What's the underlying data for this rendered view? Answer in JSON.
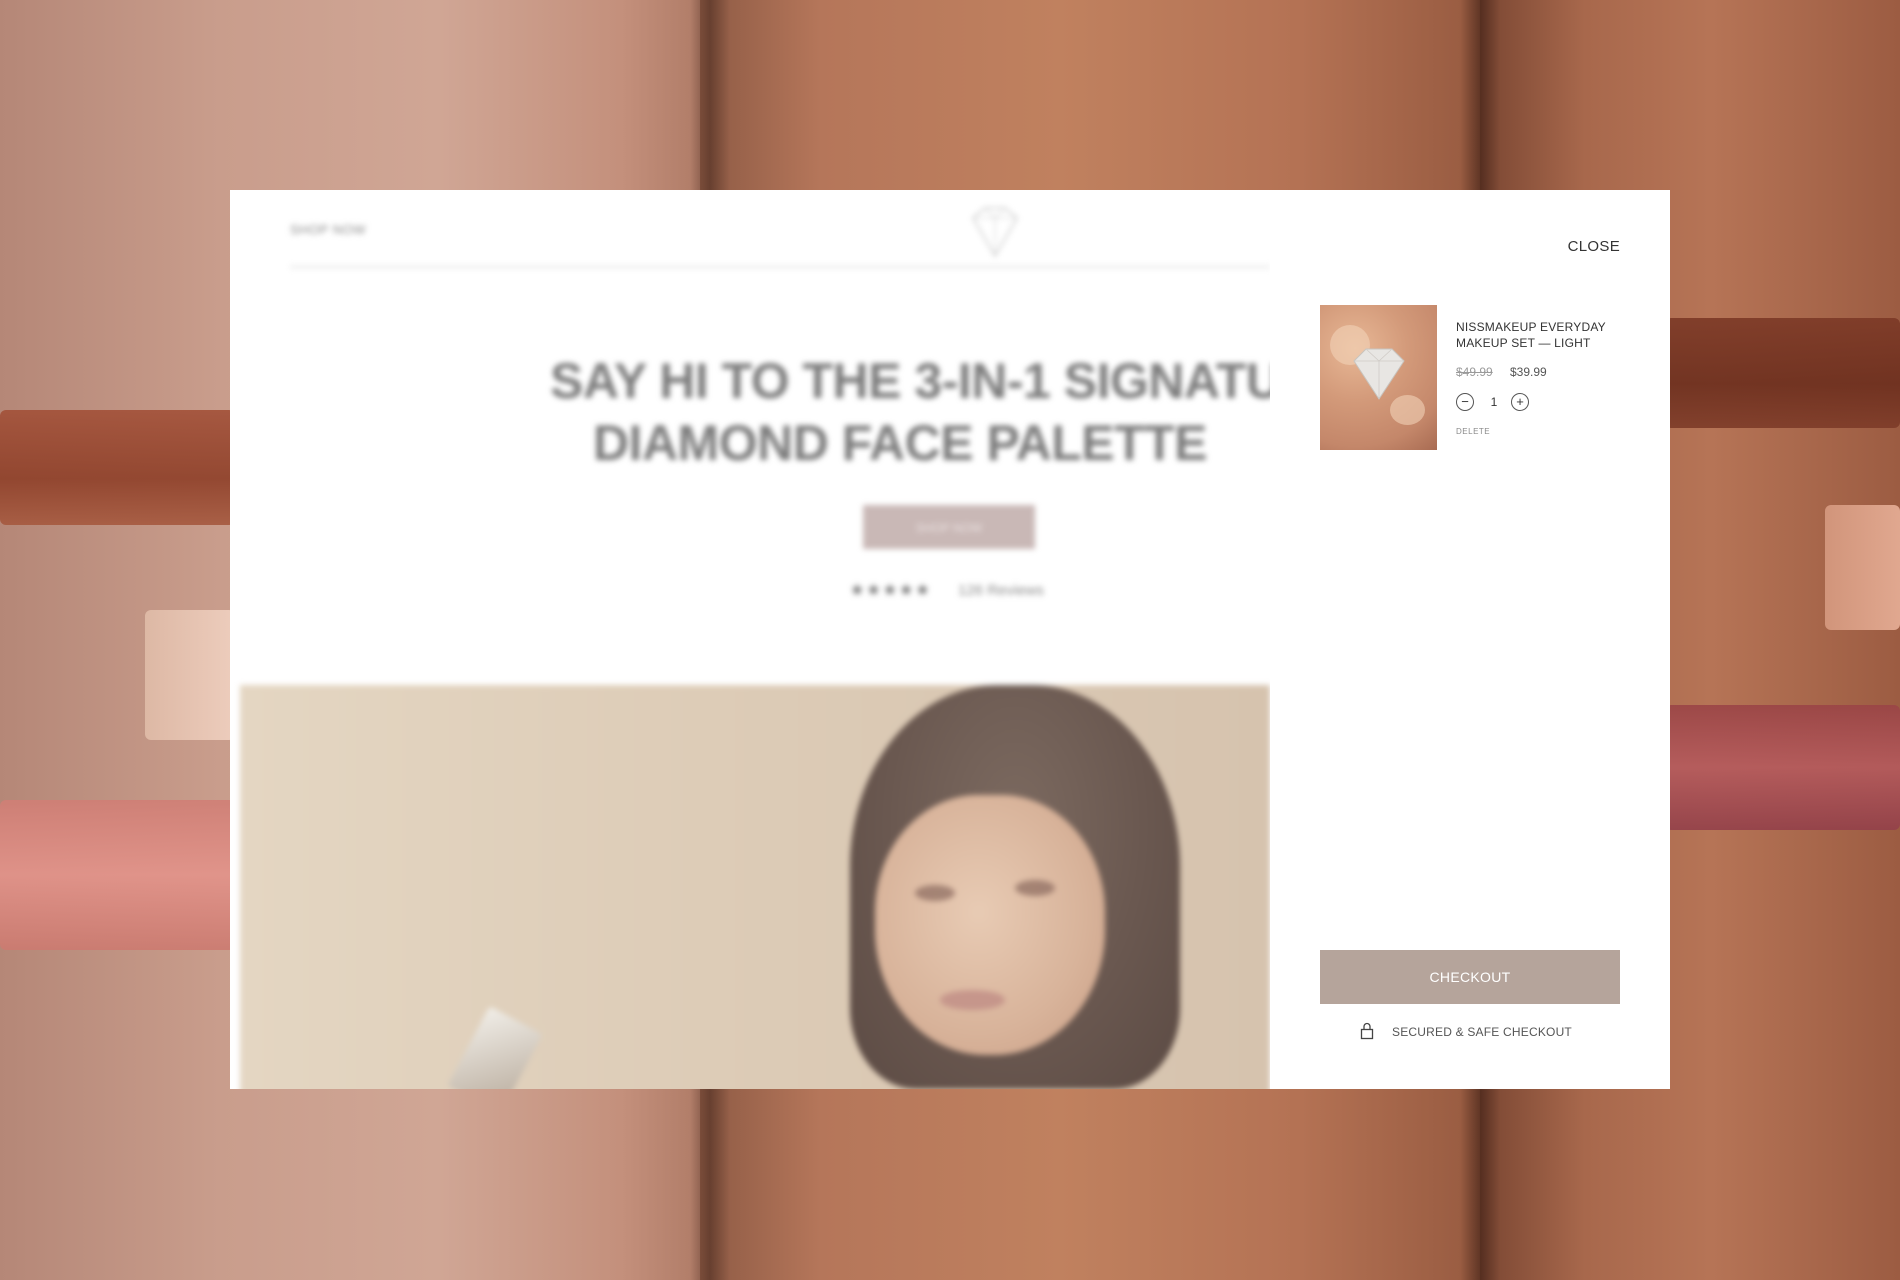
{
  "background": {
    "description_colors": {
      "skin_light": "#c99d8c",
      "skin_medium": "#b5765a",
      "skin_deep": "#9c5c42"
    }
  },
  "landing_page": {
    "nav_link": "SHOP NOW",
    "logo_icon": "diamond-logo-icon",
    "hero_title": "SAY HI TO THE 3-IN-1 SIGNATU DIAMOND FACE PALETTE",
    "hero_title_line1": "SAY HI TO THE 3-IN-1 SIGNATU",
    "hero_title_line2": "DIAMOND FACE PALETTE",
    "hero_button": "SHOP NOW",
    "rating_stars": "★★★★★",
    "reviews_label": "126 Reviews"
  },
  "cart": {
    "close_label": "CLOSE",
    "items": [
      {
        "name": "NISSMAKEUP EVERYDAY MAKEUP SET — LIGHT",
        "price_original": "$49.99",
        "price_sale": "$39.99",
        "quantity": "1",
        "decrement_icon": "minus-icon",
        "increment_icon": "plus-icon",
        "delete_label": "DELETE"
      }
    ],
    "checkout_label": "CHECKOUT",
    "secure_icon": "lock-icon",
    "secure_label": "SECURED & SAFE CHECKOUT",
    "accent_color": "#b5a49b"
  }
}
